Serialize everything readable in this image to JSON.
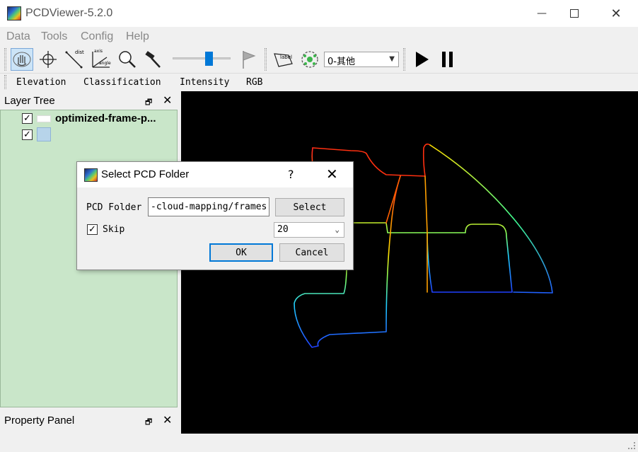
{
  "window": {
    "title": "PCDViewer-5.2.0"
  },
  "menu": [
    "Data",
    "Tools",
    "Config",
    "Help"
  ],
  "toolbar": {
    "icons": [
      "hand-select-icon",
      "crosshair-icon",
      "distance-icon",
      "axis-angle-icon",
      "zoom-icon",
      "hammer-icon",
      "slider",
      "flag-icon",
      "label-icon",
      "cluster-icon",
      "combo",
      "play-icon",
      "pause-icon"
    ],
    "dist_text": "dist",
    "axis_text": "axis",
    "angle_text": "angle",
    "label_text": "label",
    "combo_value": "0-其他",
    "slider_value": 0.6
  },
  "color_modes": [
    "Elevation",
    "Classification",
    "Intensity",
    "RGB"
  ],
  "layer_tree": {
    "title": "Layer Tree",
    "layers": [
      {
        "name": "optimized-frame-p...",
        "checked": true
      },
      {
        "name": "",
        "checked": true
      }
    ]
  },
  "property_panel": {
    "title": "Property Panel"
  },
  "dialog": {
    "title": "Select PCD Folder",
    "help": "?",
    "folder_label": "PCD Folder",
    "folder_value": "-cloud-mapping/frames",
    "select_button": "Select",
    "skip_label": "Skip",
    "skip_checked": true,
    "skip_value": "20",
    "ok_button": "OK",
    "cancel_button": "Cancel"
  },
  "colors": {
    "viewport_bg": "#000000",
    "layer_panel_bg": "#c9e6c9",
    "accent": "#0078d7"
  }
}
